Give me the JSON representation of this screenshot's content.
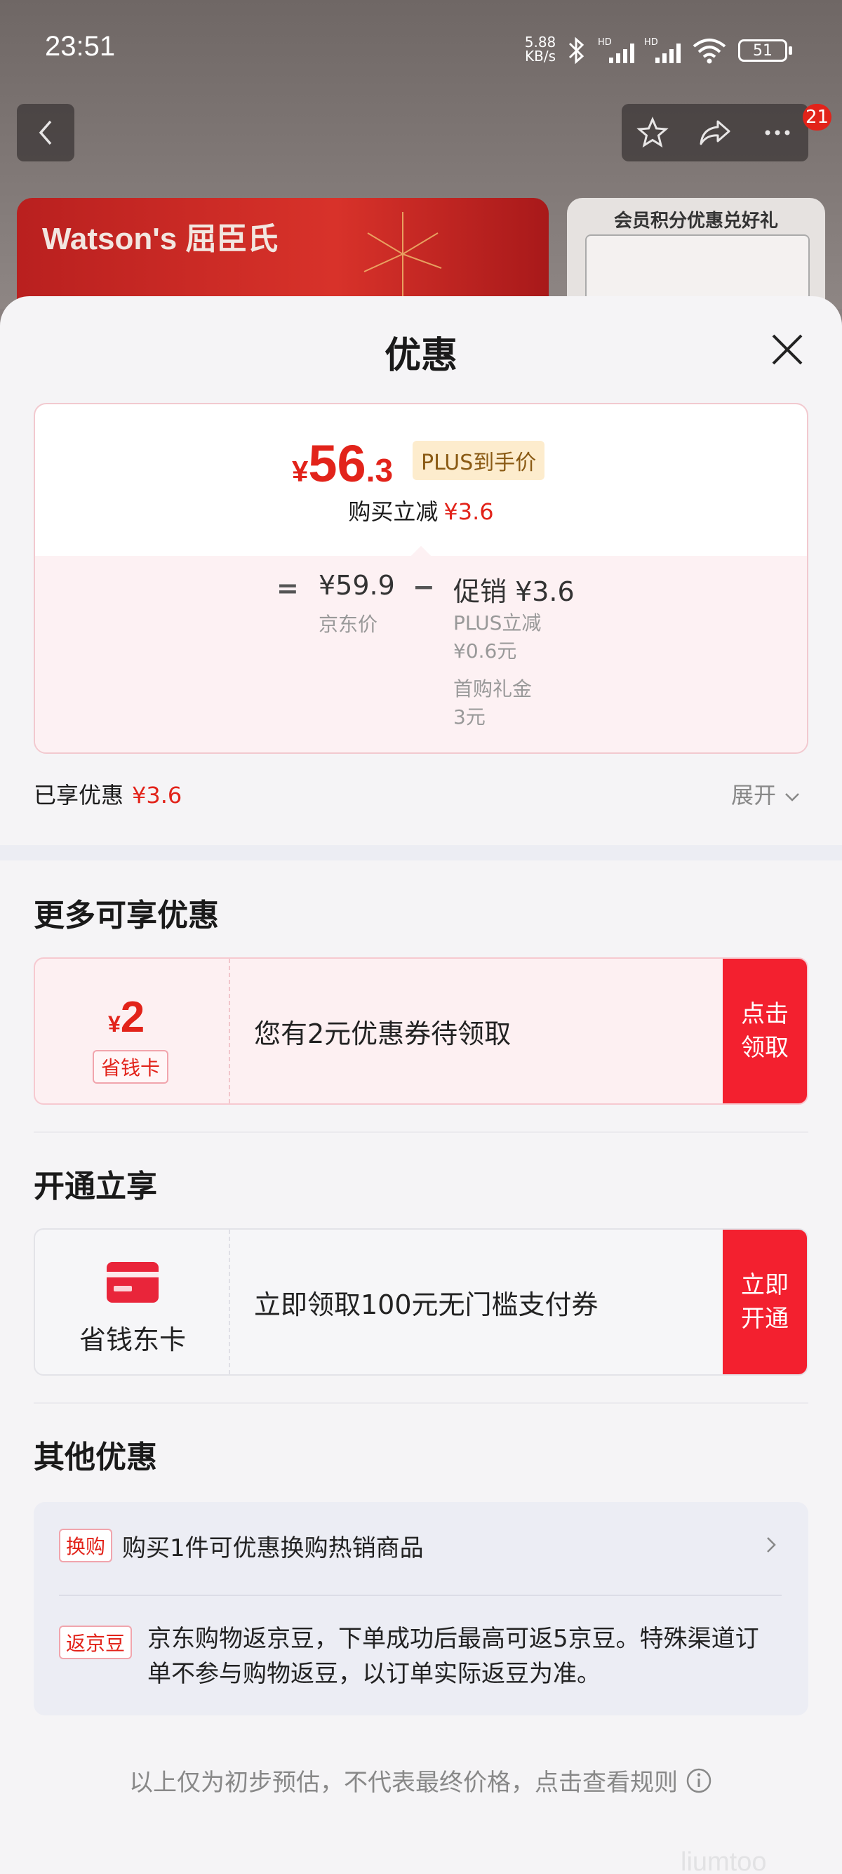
{
  "status_bar": {
    "time": "23:51",
    "net_speed_value": "5.88",
    "net_speed_unit": "KB/s",
    "battery": "51"
  },
  "page": {
    "badge_count": "21",
    "banner_left_brand": "Watson's 屈臣氏",
    "banner_right_title": "会员积分优惠兑好礼"
  },
  "sheet": {
    "title": "优惠",
    "final_price": {
      "currency": "¥",
      "integer": "56",
      "decimal": ".3"
    },
    "plus_tag": "PLUS到手价",
    "instant_label": "购买立减",
    "instant_value": "¥3.6",
    "equals": "=",
    "jd_price": "¥59.9",
    "jd_price_label": "京东价",
    "minus": "−",
    "promo_label": "促销 ¥3.6",
    "promo_sub1_line1": "PLUS立减",
    "promo_sub1_line2": "¥0.6元",
    "promo_sub2_line1": "首购礼金",
    "promo_sub2_line2": "3元",
    "enjoyed_label": "已享优惠",
    "enjoyed_value": "¥3.6",
    "expand_label": "展开"
  },
  "more": {
    "heading": "更多可享优惠",
    "coupon_currency": "¥",
    "coupon_amount": "2",
    "coupon_tag": "省钱卡",
    "coupon_message": "您有2元优惠券待领取",
    "coupon_action_line1": "点击",
    "coupon_action_line2": "领取"
  },
  "open": {
    "heading": "开通立享",
    "card_name": "省钱东卡",
    "message": "立即领取100元无门槛支付券",
    "action_line1": "立即",
    "action_line2": "开通"
  },
  "other": {
    "heading": "其他优惠",
    "row1_tag": "换购",
    "row1_text": "购买1件可优惠换购热销商品",
    "row2_tag": "返京豆",
    "row2_text": "京东购物返京豆，下单成功后最高可返5京豆。特殊渠道订单不参与购物返豆，以订单实际返豆为准。"
  },
  "footer": {
    "note": "以上仅为初步预估，不代表最终价格，点击查看规则"
  },
  "watermark": "liumtoo",
  "colors": {
    "accent_red": "#e2231a",
    "button_red": "#f3202f",
    "plus_gold": "#8a5a14"
  }
}
